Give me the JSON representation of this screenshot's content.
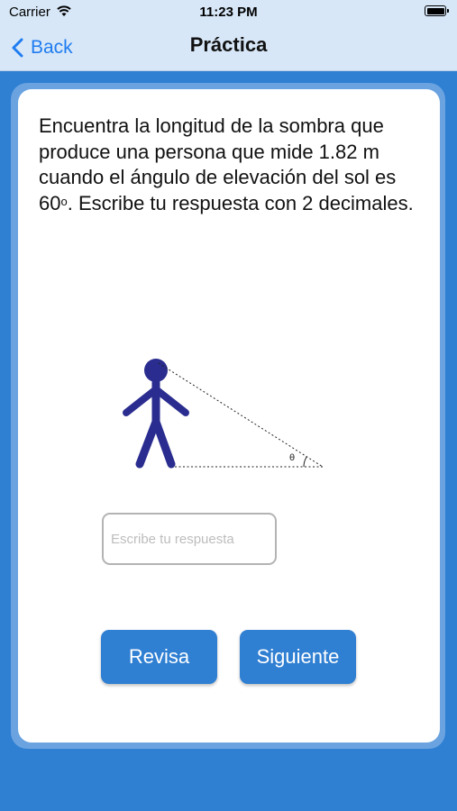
{
  "status_bar": {
    "carrier": "Carrier",
    "time": "11:23 PM"
  },
  "nav": {
    "back_label": "Back",
    "title": "Práctica"
  },
  "question": {
    "text_before_degree": "Encuentra la longitud de la sombra que produce una persona que mide 1.82 m cuando el ángulo de elevación del sol es 60",
    "degree_symbol": "o",
    "text_after_degree": ". Escribe tu respuesta con 2 decimales."
  },
  "figure": {
    "angle_label": "θ"
  },
  "answer": {
    "placeholder": "Escribe tu respuesta",
    "value": ""
  },
  "buttons": {
    "check_label": "Revisa",
    "next_label": "Siguiente"
  },
  "colors": {
    "background": "#2f7fd2",
    "nav_background": "#d7e7f7",
    "accent": "#1f7cf0",
    "figure": "#2a2d8f",
    "button": "#2f7fd2"
  },
  "icons": {
    "back": "chevron-left-icon",
    "wifi": "wifi-icon",
    "battery": "battery-icon"
  }
}
